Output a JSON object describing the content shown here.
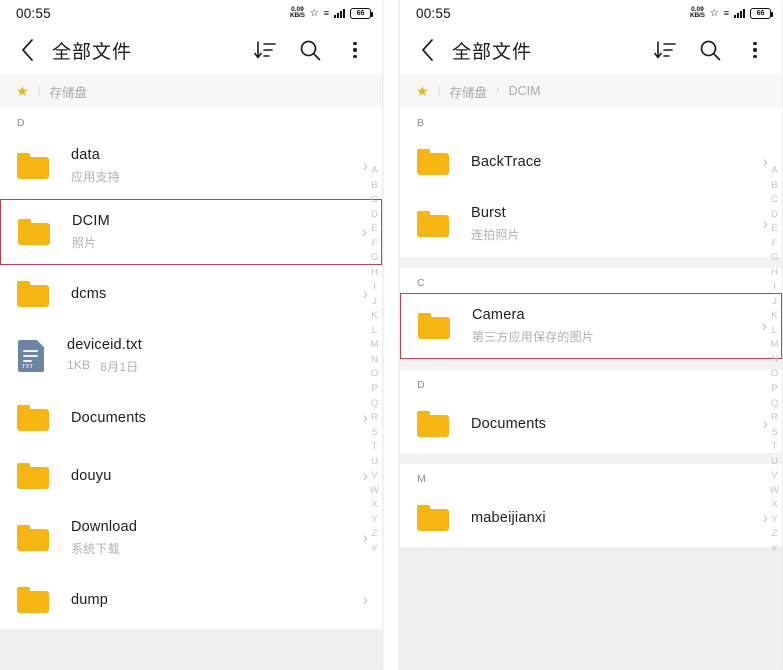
{
  "status_bar": {
    "time": "00:55",
    "net_speed_value": "0.09",
    "net_speed_unit": "KB/S",
    "star_icon": "star-outline-icon",
    "signal_icon": "signal-bars-icon",
    "battery_level": "66"
  },
  "app_bar": {
    "back_icon": "back-chevron-icon",
    "title": "全部文件",
    "sort_icon": "sort-descending-icon",
    "search_icon": "search-icon",
    "overflow_icon": "more-vertical-icon"
  },
  "alpha_index": [
    "A",
    "B",
    "C",
    "D",
    "E",
    "F",
    "G",
    "H",
    "I",
    "J",
    "K",
    "L",
    "M",
    "N",
    "O",
    "P",
    "Q",
    "R",
    "S",
    "T",
    "U",
    "V",
    "W",
    "X",
    "Y",
    "Z",
    "#"
  ],
  "colors": {
    "folder": "#f7b512",
    "highlight": "#cf3a4e",
    "star": "#f2b01e",
    "txt_file": "#6c85a3"
  },
  "left_panel": {
    "breadcrumb": {
      "star_icon": "star-icon",
      "items": [
        "存储盘"
      ]
    },
    "sections": [
      {
        "letter": "D",
        "items": [
          {
            "icon": "folder-icon",
            "name": "data",
            "sub": "应用支持",
            "highlight": false,
            "chevron": "›"
          },
          {
            "icon": "folder-icon",
            "name": "DCIM",
            "sub": "照片",
            "highlight": true,
            "chevron": "›"
          },
          {
            "icon": "folder-icon",
            "name": "dcms",
            "sub": "",
            "highlight": false,
            "chevron": "›"
          },
          {
            "icon": "txt-file-icon",
            "name": "deviceid.txt",
            "sub": "1KB",
            "sub2": "8月1日",
            "highlight": false,
            "chevron": ""
          },
          {
            "icon": "folder-icon",
            "name": "Documents",
            "sub": "",
            "highlight": false,
            "chevron": "›"
          },
          {
            "icon": "folder-icon",
            "name": "douyu",
            "sub": "",
            "highlight": false,
            "chevron": "›"
          },
          {
            "icon": "folder-icon",
            "name": "Download",
            "sub": "系统下载",
            "highlight": false,
            "chevron": "›"
          },
          {
            "icon": "folder-icon",
            "name": "dump",
            "sub": "",
            "highlight": false,
            "chevron": "›"
          }
        ]
      }
    ]
  },
  "right_panel": {
    "breadcrumb": {
      "star_icon": "star-icon",
      "items": [
        "存储盘",
        "DCIM"
      ],
      "separator": "›"
    },
    "sections": [
      {
        "letter": "B",
        "items": [
          {
            "icon": "folder-icon",
            "name": "BackTrace",
            "sub": "",
            "highlight": false,
            "chevron": "›"
          },
          {
            "icon": "folder-icon",
            "name": "Burst",
            "sub": "连拍照片",
            "highlight": false,
            "chevron": "›"
          }
        ]
      },
      {
        "letter": "C",
        "items": [
          {
            "icon": "folder-icon",
            "name": "Camera",
            "sub": "第三方应用保存的图片",
            "highlight": true,
            "chevron": "›"
          }
        ]
      },
      {
        "letter": "D",
        "items": [
          {
            "icon": "folder-icon",
            "name": "Documents",
            "sub": "",
            "highlight": false,
            "chevron": "›"
          }
        ]
      },
      {
        "letter": "M",
        "items": [
          {
            "icon": "folder-icon",
            "name": "mabeijianxi",
            "sub": "",
            "highlight": false,
            "chevron": "›"
          }
        ]
      }
    ]
  }
}
